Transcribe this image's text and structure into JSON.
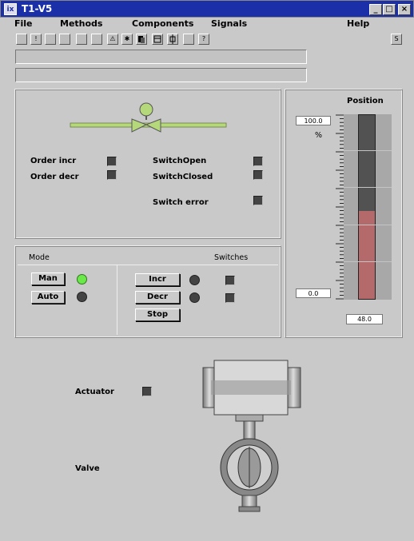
{
  "window": {
    "title": "T1-V5",
    "app_icon": "ix"
  },
  "menu": [
    "File",
    "Methods",
    "Components",
    "Signals",
    "Help"
  ],
  "toolbar": {
    "icons": [
      "blank",
      "exclaim",
      "blank",
      "blank",
      "blank",
      "blank",
      "warning",
      "asterisk",
      "stack",
      "window",
      "plug",
      "blank",
      "help"
    ],
    "help_label": "?",
    "warning_label": "⚠",
    "exclaim_label": "!",
    "asterisk_label": "✱",
    "right_icon_label": "S"
  },
  "indicators": {
    "order_incr": "Order incr",
    "order_decr": "Order decr",
    "switch_open": "SwitchOpen",
    "switch_closed": "SwitchClosed",
    "switch_error": "Switch error"
  },
  "mode": {
    "title": "Mode",
    "man": "Man",
    "auto": "Auto",
    "man_active": true,
    "auto_active": false
  },
  "switches": {
    "title": "Switches",
    "incr": "Incr",
    "decr": "Decr",
    "stop": "Stop"
  },
  "position": {
    "title": "Position",
    "max": "100.0",
    "min": "0.0",
    "unit": "%",
    "value": "48.0",
    "fill_fraction": 0.48
  },
  "actuator": {
    "label": "Actuator"
  },
  "valve": {
    "label": "Valve"
  },
  "colors": {
    "titlebar": "#1a2fa8",
    "pipe": "#b5d97a",
    "led_on": "#6be84a",
    "bar_fill": "#b46a6a",
    "bar_empty": "#525252"
  }
}
